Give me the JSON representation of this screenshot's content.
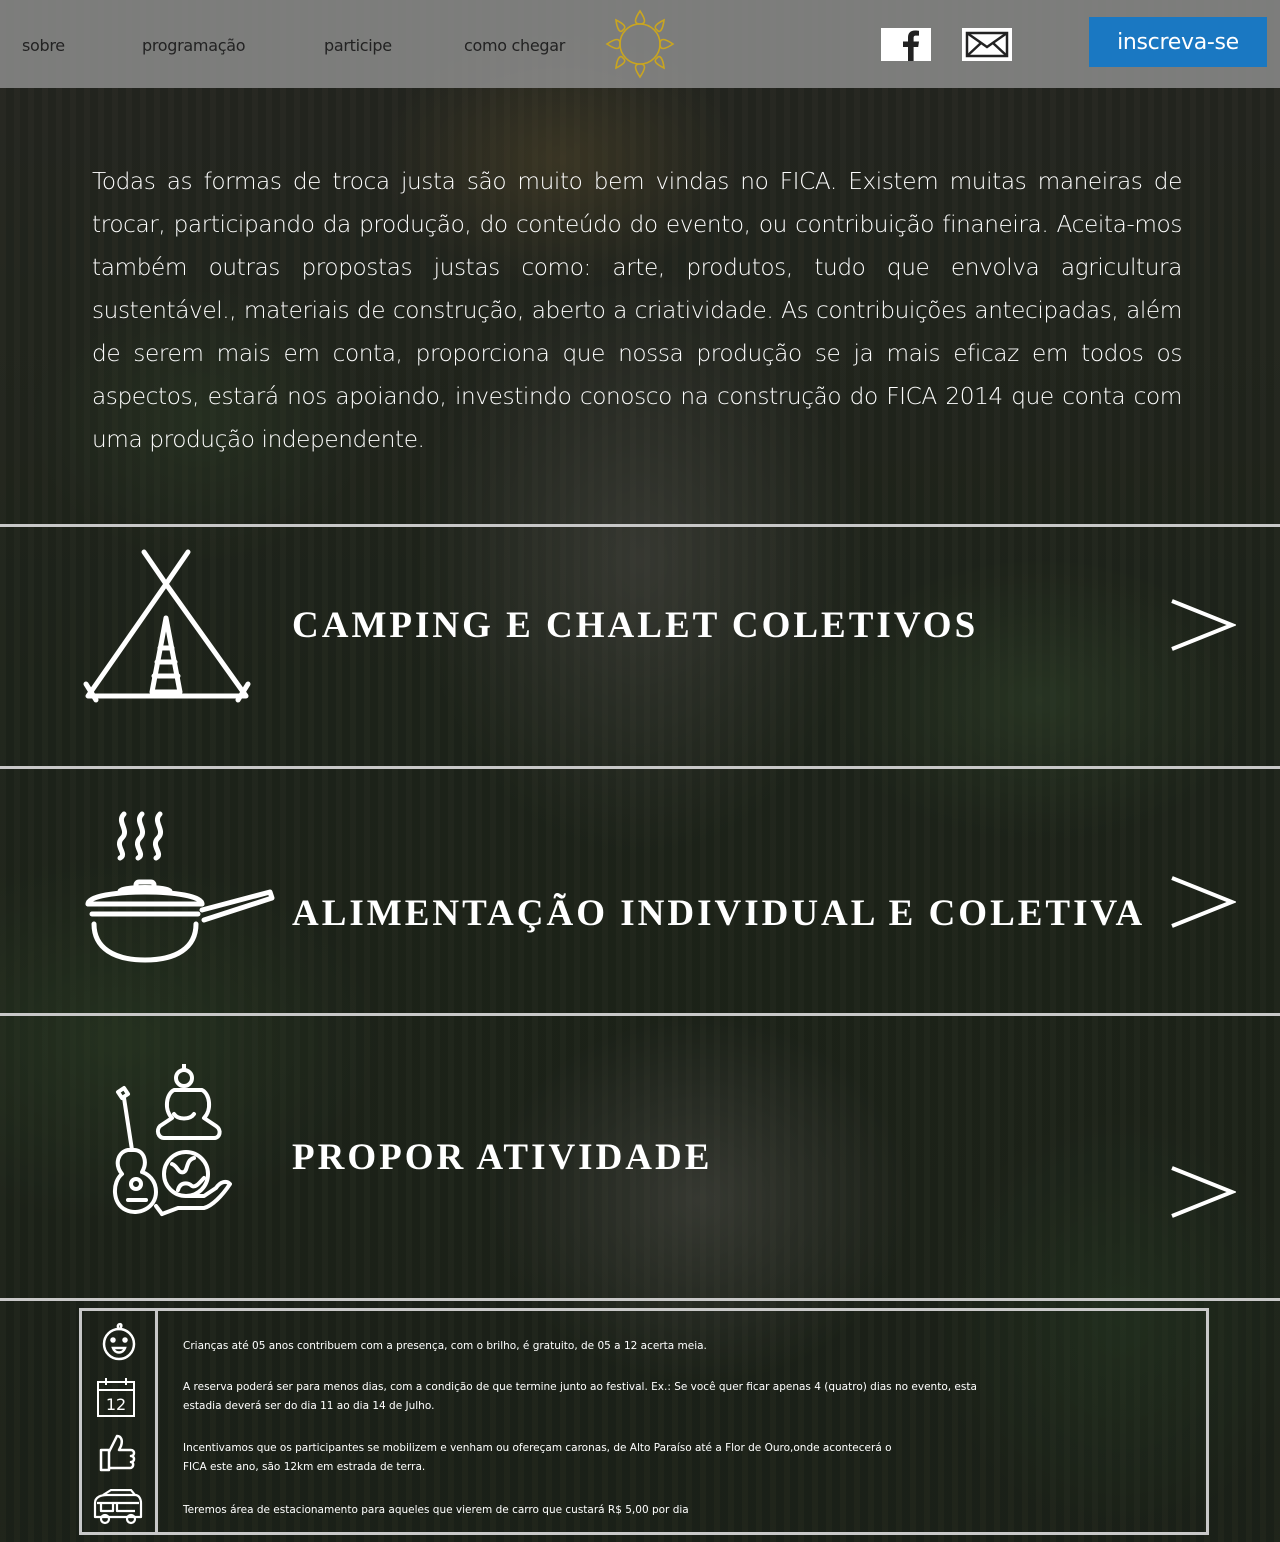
{
  "nav": {
    "items": [
      {
        "label": "sobre"
      },
      {
        "label": "programação"
      },
      {
        "label": "participe"
      },
      {
        "label": "como chegar"
      }
    ],
    "logo_icon": "lotus-mandala-icon",
    "social": [
      {
        "icon": "facebook-icon"
      },
      {
        "icon": "mail-icon"
      }
    ],
    "cta_label": "inscreva-se"
  },
  "intro": {
    "text": "Todas as formas de troca justa são muito bem vindas no FICA. Existem muitas maneiras de trocar, participando da produção, do conteúdo do evento, ou contribuição finaneira. Aceita-mos também outras propostas justas como: arte, produtos, tudo que envolva agricultura sustentável., materiais de construção, aberto a criatividade. As contribuições antecipadas, além de serem mais em conta, proporciona que nossa produção se ja mais eficaz em todos os aspectos, estará nos apoiando, investindo conosco na construção do FICA 2014 que conta com uma produção independente."
  },
  "sections": [
    {
      "title": "CAMPING E CHALET COLETIVOS",
      "icon": "teepee-icon",
      "arrow": "chevron-right-icon"
    },
    {
      "title": "ALIMENTAÇÃO INDIVIDUAL E COLETIVA",
      "icon": "cooking-pan-icon",
      "arrow": "chevron-right-icon"
    },
    {
      "title": "PROPOR ATIVIDADE",
      "icon": "guitar-buddha-globe-icon",
      "arrow": "chevron-right-icon"
    }
  ],
  "info": {
    "items": [
      {
        "icon": "child-face-icon",
        "text": "Crianças até 05 anos contribuem com a presença, com o brilho, é gratuito, de 05 a 12 acerta meia."
      },
      {
        "icon": "calendar-icon",
        "calendar_day": "12",
        "text": "A reserva poderá ser para menos dias, com a condição de que termine junto ao festival. Ex.: Se você quer ficar apenas 4 (quatro) dias no evento, esta estadia deverá ser do dia 11 ao dia 14 de Julho."
      },
      {
        "icon": "thumbs-up-icon",
        "text": "Incentivamos que os participantes se mobilizem e venham ou ofereçam caronas, de Alto Paraíso até a Flor de Ouro,onde acontecerá o FICA este ano, são 12km em estrada de terra."
      },
      {
        "icon": "van-icon",
        "text": "Teremos área de estacionamento para aqueles que vierem de carro que custará R$ 5,00 por dia"
      }
    ]
  },
  "colors": {
    "header_bg": "#969696",
    "cta_bg": "#1a78c2",
    "logo_gold": "#c9a520",
    "divider": "#c8c8c8"
  }
}
